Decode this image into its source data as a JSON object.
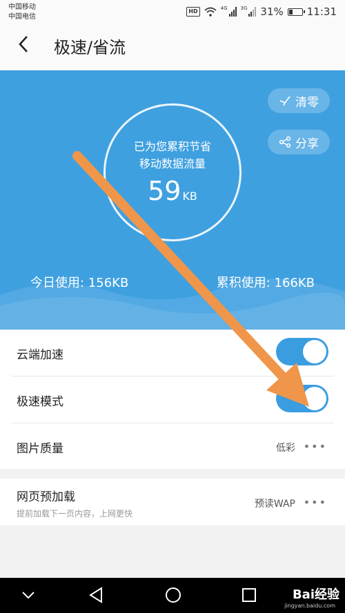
{
  "status_bar": {
    "carrier1": "中国移动",
    "carrier2": "中国电信",
    "hd": "HD",
    "net1": "4G",
    "net2": "3G",
    "battery": "31%",
    "time": "11:31",
    "battery_level": 0.31
  },
  "header": {
    "back_icon": "chevron-left-icon",
    "title": "极速/省流"
  },
  "hero": {
    "line1": "已为您累积节省",
    "line2": "移动数据流量",
    "saved_value": "59",
    "saved_unit": "KB",
    "clear_label": "清零",
    "share_label": "分享",
    "today_usage": "今日使用: 156KB",
    "total_usage": "累积使用: 166KB"
  },
  "settings": {
    "cloud_accel_label": "云端加速",
    "cloud_accel_on": true,
    "speed_mode_label": "极速模式",
    "speed_mode_on": true,
    "image_quality_label": "图片质量",
    "image_quality_value": "低彩",
    "preload_label": "网页预加载",
    "preload_desc": "提前加载下一页内容，上网更快",
    "preload_value": "预读WAP",
    "more": "•••"
  },
  "watermark": {
    "main": "Bai经验",
    "sub": "jingyan.baidu.com"
  },
  "colors": {
    "hero_bg": "#3fa0e0",
    "toggle_on": "#3a9de0",
    "annotation_arrow": "#f0964a"
  }
}
